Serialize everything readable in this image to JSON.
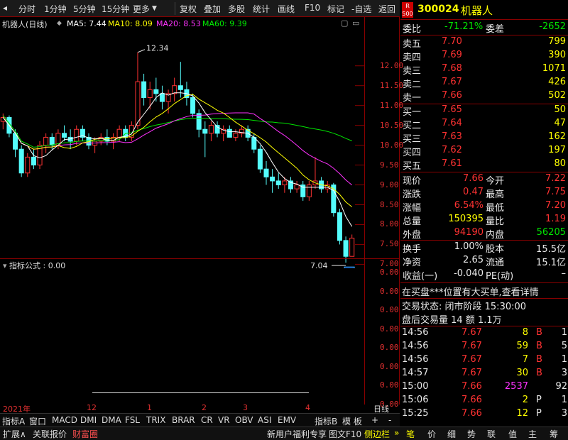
{
  "toolbar": {
    "items": [
      "分时",
      "1分钟",
      "5分钟",
      "15分钟",
      "更多",
      "复权",
      "叠加",
      "多股",
      "统计",
      "画线",
      "F10",
      "标记",
      "-自选",
      "返回"
    ]
  },
  "chart": {
    "title": "机器人(日线)",
    "ma5": "MA5: 7.44",
    "ma10": "MA10: 8.09",
    "ma20": "MA20: 8.53",
    "ma60": "MA60: 9.39",
    "high_label": "12.34",
    "low_label": "7.04",
    "cai_badge": "财",
    "y_ticks": [
      "12.00",
      "11.50",
      "11.00",
      "10.50",
      "10.00",
      "9.50",
      "9.00",
      "8.50",
      "8.00",
      "7.50",
      "7.00"
    ],
    "indicator_title": "指标公式 : 0.00",
    "ind_ticks": [
      "0.00",
      "0.00",
      "0.00",
      "0.00",
      "0.00",
      "0.00",
      "0.00",
      "0.00"
    ],
    "x_ticks": [
      "2021年",
      "12",
      "1",
      "2",
      "3",
      "4"
    ],
    "period": "日线",
    "colors": {
      "up": "#ff3232",
      "down": "#54fcfc",
      "ma5": "#ffffff",
      "ma10": "#ffff00",
      "ma20": "#ff32ff",
      "ma60": "#00e600"
    }
  },
  "chart_data": {
    "type": "candlestick",
    "title": "机器人(日线)",
    "ylim": [
      6.9,
      12.8
    ],
    "ohlc": [
      [
        10.6,
        10.8,
        10.4,
        10.7
      ],
      [
        10.7,
        10.75,
        10.2,
        10.3
      ],
      [
        10.3,
        10.4,
        9.7,
        9.9
      ],
      [
        9.9,
        10.0,
        9.2,
        9.3
      ],
      [
        9.3,
        9.8,
        9.2,
        9.7
      ],
      [
        9.7,
        9.9,
        9.4,
        9.5
      ],
      [
        9.5,
        10.1,
        9.4,
        10.0
      ],
      [
        10.0,
        10.3,
        9.8,
        10.2
      ],
      [
        10.2,
        10.3,
        9.9,
        10.0
      ],
      [
        10.0,
        10.4,
        9.9,
        10.3
      ],
      [
        10.3,
        10.5,
        10.1,
        10.2
      ],
      [
        10.2,
        10.4,
        9.9,
        10.1
      ],
      [
        10.1,
        10.5,
        10.0,
        10.4
      ],
      [
        10.4,
        10.5,
        10.1,
        10.2
      ],
      [
        10.2,
        10.3,
        9.9,
        10.0
      ],
      [
        10.0,
        10.2,
        9.8,
        10.1
      ],
      [
        10.1,
        10.3,
        10.0,
        10.2
      ],
      [
        10.2,
        10.4,
        10.0,
        10.1
      ],
      [
        10.1,
        10.3,
        9.9,
        10.2
      ],
      [
        10.2,
        10.5,
        10.1,
        10.4
      ],
      [
        10.4,
        10.5,
        10.1,
        10.2
      ],
      [
        10.2,
        10.6,
        10.1,
        10.5
      ],
      [
        10.5,
        12.34,
        10.4,
        11.6
      ],
      [
        11.6,
        11.8,
        11.0,
        11.2
      ],
      [
        11.2,
        11.6,
        10.9,
        11.4
      ],
      [
        11.4,
        11.7,
        11.1,
        11.3
      ],
      [
        11.3,
        11.5,
        10.9,
        11.1
      ],
      [
        11.1,
        11.4,
        10.8,
        11.3
      ],
      [
        11.3,
        11.7,
        11.1,
        11.5
      ],
      [
        11.5,
        12.1,
        11.2,
        11.4
      ],
      [
        11.4,
        11.6,
        11.0,
        11.2
      ],
      [
        11.2,
        11.3,
        10.7,
        10.8
      ],
      [
        10.8,
        10.9,
        10.2,
        10.4
      ],
      [
        10.4,
        10.6,
        9.7,
        10.3
      ],
      [
        10.3,
        10.6,
        10.1,
        10.5
      ],
      [
        10.5,
        10.6,
        10.2,
        10.3
      ],
      [
        10.3,
        10.5,
        10.1,
        10.4
      ],
      [
        10.4,
        10.5,
        10.2,
        10.2
      ],
      [
        10.2,
        10.4,
        10.1,
        10.3
      ],
      [
        10.3,
        10.5,
        10.2,
        10.4
      ],
      [
        10.4,
        10.5,
        10.1,
        10.2
      ],
      [
        10.2,
        10.3,
        9.8,
        9.9
      ],
      [
        9.9,
        10.0,
        9.3,
        9.4
      ],
      [
        9.4,
        9.6,
        9.0,
        9.2
      ],
      [
        9.2,
        9.4,
        8.8,
        9.1
      ],
      [
        9.1,
        9.3,
        8.9,
        9.0
      ],
      [
        9.0,
        9.2,
        8.8,
        9.1
      ],
      [
        9.1,
        9.2,
        8.8,
        8.9
      ],
      [
        8.9,
        9.1,
        8.8,
        9.0
      ],
      [
        9.0,
        9.1,
        8.6,
        8.7
      ],
      [
        8.7,
        9.1,
        8.6,
        9.0
      ],
      [
        9.0,
        9.7,
        8.9,
        9.1
      ],
      [
        9.1,
        9.2,
        8.8,
        8.9
      ],
      [
        8.9,
        9.1,
        8.8,
        9.0
      ],
      [
        9.0,
        9.05,
        8.2,
        8.3
      ],
      [
        8.3,
        8.4,
        7.5,
        7.6
      ],
      [
        7.6,
        7.7,
        7.04,
        7.2
      ],
      [
        7.2,
        7.75,
        7.2,
        7.66
      ]
    ],
    "ma5_last": 7.44,
    "ma10_last": 8.09,
    "ma20_last": 8.53,
    "ma60_last": 9.39,
    "x_ticks": [
      "2021年",
      "12",
      "1",
      "2",
      "3",
      "4"
    ]
  },
  "stock": {
    "badge": "R\n500",
    "code": "300024",
    "name": "机器人"
  },
  "weibi": {
    "label": "委比",
    "value": "-71.21%",
    "wc_label": "委差",
    "wc_value": "-2652"
  },
  "sell": [
    {
      "label": "卖五",
      "price": "7.70",
      "vol": "799"
    },
    {
      "label": "卖四",
      "price": "7.69",
      "vol": "390"
    },
    {
      "label": "卖三",
      "price": "7.68",
      "vol": "1071"
    },
    {
      "label": "卖二",
      "price": "7.67",
      "vol": "426"
    },
    {
      "label": "卖一",
      "price": "7.66",
      "vol": "502"
    }
  ],
  "buy": [
    {
      "label": "买一",
      "price": "7.65",
      "vol": "50"
    },
    {
      "label": "买二",
      "price": "7.64",
      "vol": "47"
    },
    {
      "label": "买三",
      "price": "7.63",
      "vol": "162"
    },
    {
      "label": "买四",
      "price": "7.62",
      "vol": "197"
    },
    {
      "label": "买五",
      "price": "7.61",
      "vol": "80"
    }
  ],
  "quote": [
    {
      "l1": "现价",
      "v1": "7.66",
      "l2": "今开",
      "v2": "7.22"
    },
    {
      "l1": "涨跌",
      "v1": "0.47",
      "l2": "最高",
      "v2": "7.75"
    },
    {
      "l1": "涨幅",
      "v1": "6.54%",
      "l2": "最低",
      "v2": "7.20"
    },
    {
      "l1": "总量",
      "v1": "150395",
      "l2": "量比",
      "v2": "1.19"
    },
    {
      "l1": "外盘",
      "v1": "94190",
      "l2": "内盘",
      "v2": "56205"
    }
  ],
  "fin": [
    {
      "l1": "换手",
      "v1": "1.00%",
      "l2": "股本",
      "v2": "15.5亿"
    },
    {
      "l1": "净资",
      "v1": "2.65",
      "l2": "流通",
      "v2": "15.1亿"
    },
    {
      "l1": "收益(一)",
      "v1": "-0.040",
      "l2": "PE(动)",
      "v2": "–"
    }
  ],
  "notice": "在买盘***位置有大买单,查看详情",
  "trade_status": "交易状态: 闭市阶段 15:30:00",
  "after_hours": "盘后交易量 14 额 1.1万",
  "ticks": [
    {
      "time": "14:56",
      "price": "7.67",
      "vol": "8",
      "bs": "B",
      "n": "1"
    },
    {
      "time": "14:56",
      "price": "7.67",
      "vol": "59",
      "bs": "B",
      "n": "5"
    },
    {
      "time": "14:56",
      "price": "7.67",
      "vol": "7",
      "bs": "B",
      "n": "1"
    },
    {
      "time": "14:57",
      "price": "7.67",
      "vol": "30",
      "bs": "B",
      "n": "3"
    },
    {
      "time": "15:00",
      "price": "7.66",
      "vol": "2537",
      "bs": "",
      "n": "92"
    },
    {
      "time": "15:06",
      "price": "7.66",
      "vol": "2",
      "bs": "P",
      "n": "1"
    },
    {
      "time": "15:25",
      "price": "7.66",
      "vol": "12",
      "bs": "P",
      "n": "3"
    }
  ],
  "bottom_tabs": [
    "指标A",
    "窗口",
    "MACD",
    "DMI",
    "DMA",
    "FSL",
    "TRIX",
    "BRAR",
    "CR",
    "VR",
    "OBV",
    "ASI",
    "EMV",
    "指标B",
    "模 板",
    "+",
    "-"
  ],
  "status_left": [
    "扩展∧",
    "关联报价",
    "财富圈"
  ],
  "status_mid": [
    "新用户福利专享",
    "图文F10",
    "侧边栏"
  ],
  "status_right": [
    "笔",
    "价",
    "细",
    "势",
    "联",
    "值",
    "主",
    "筹"
  ]
}
